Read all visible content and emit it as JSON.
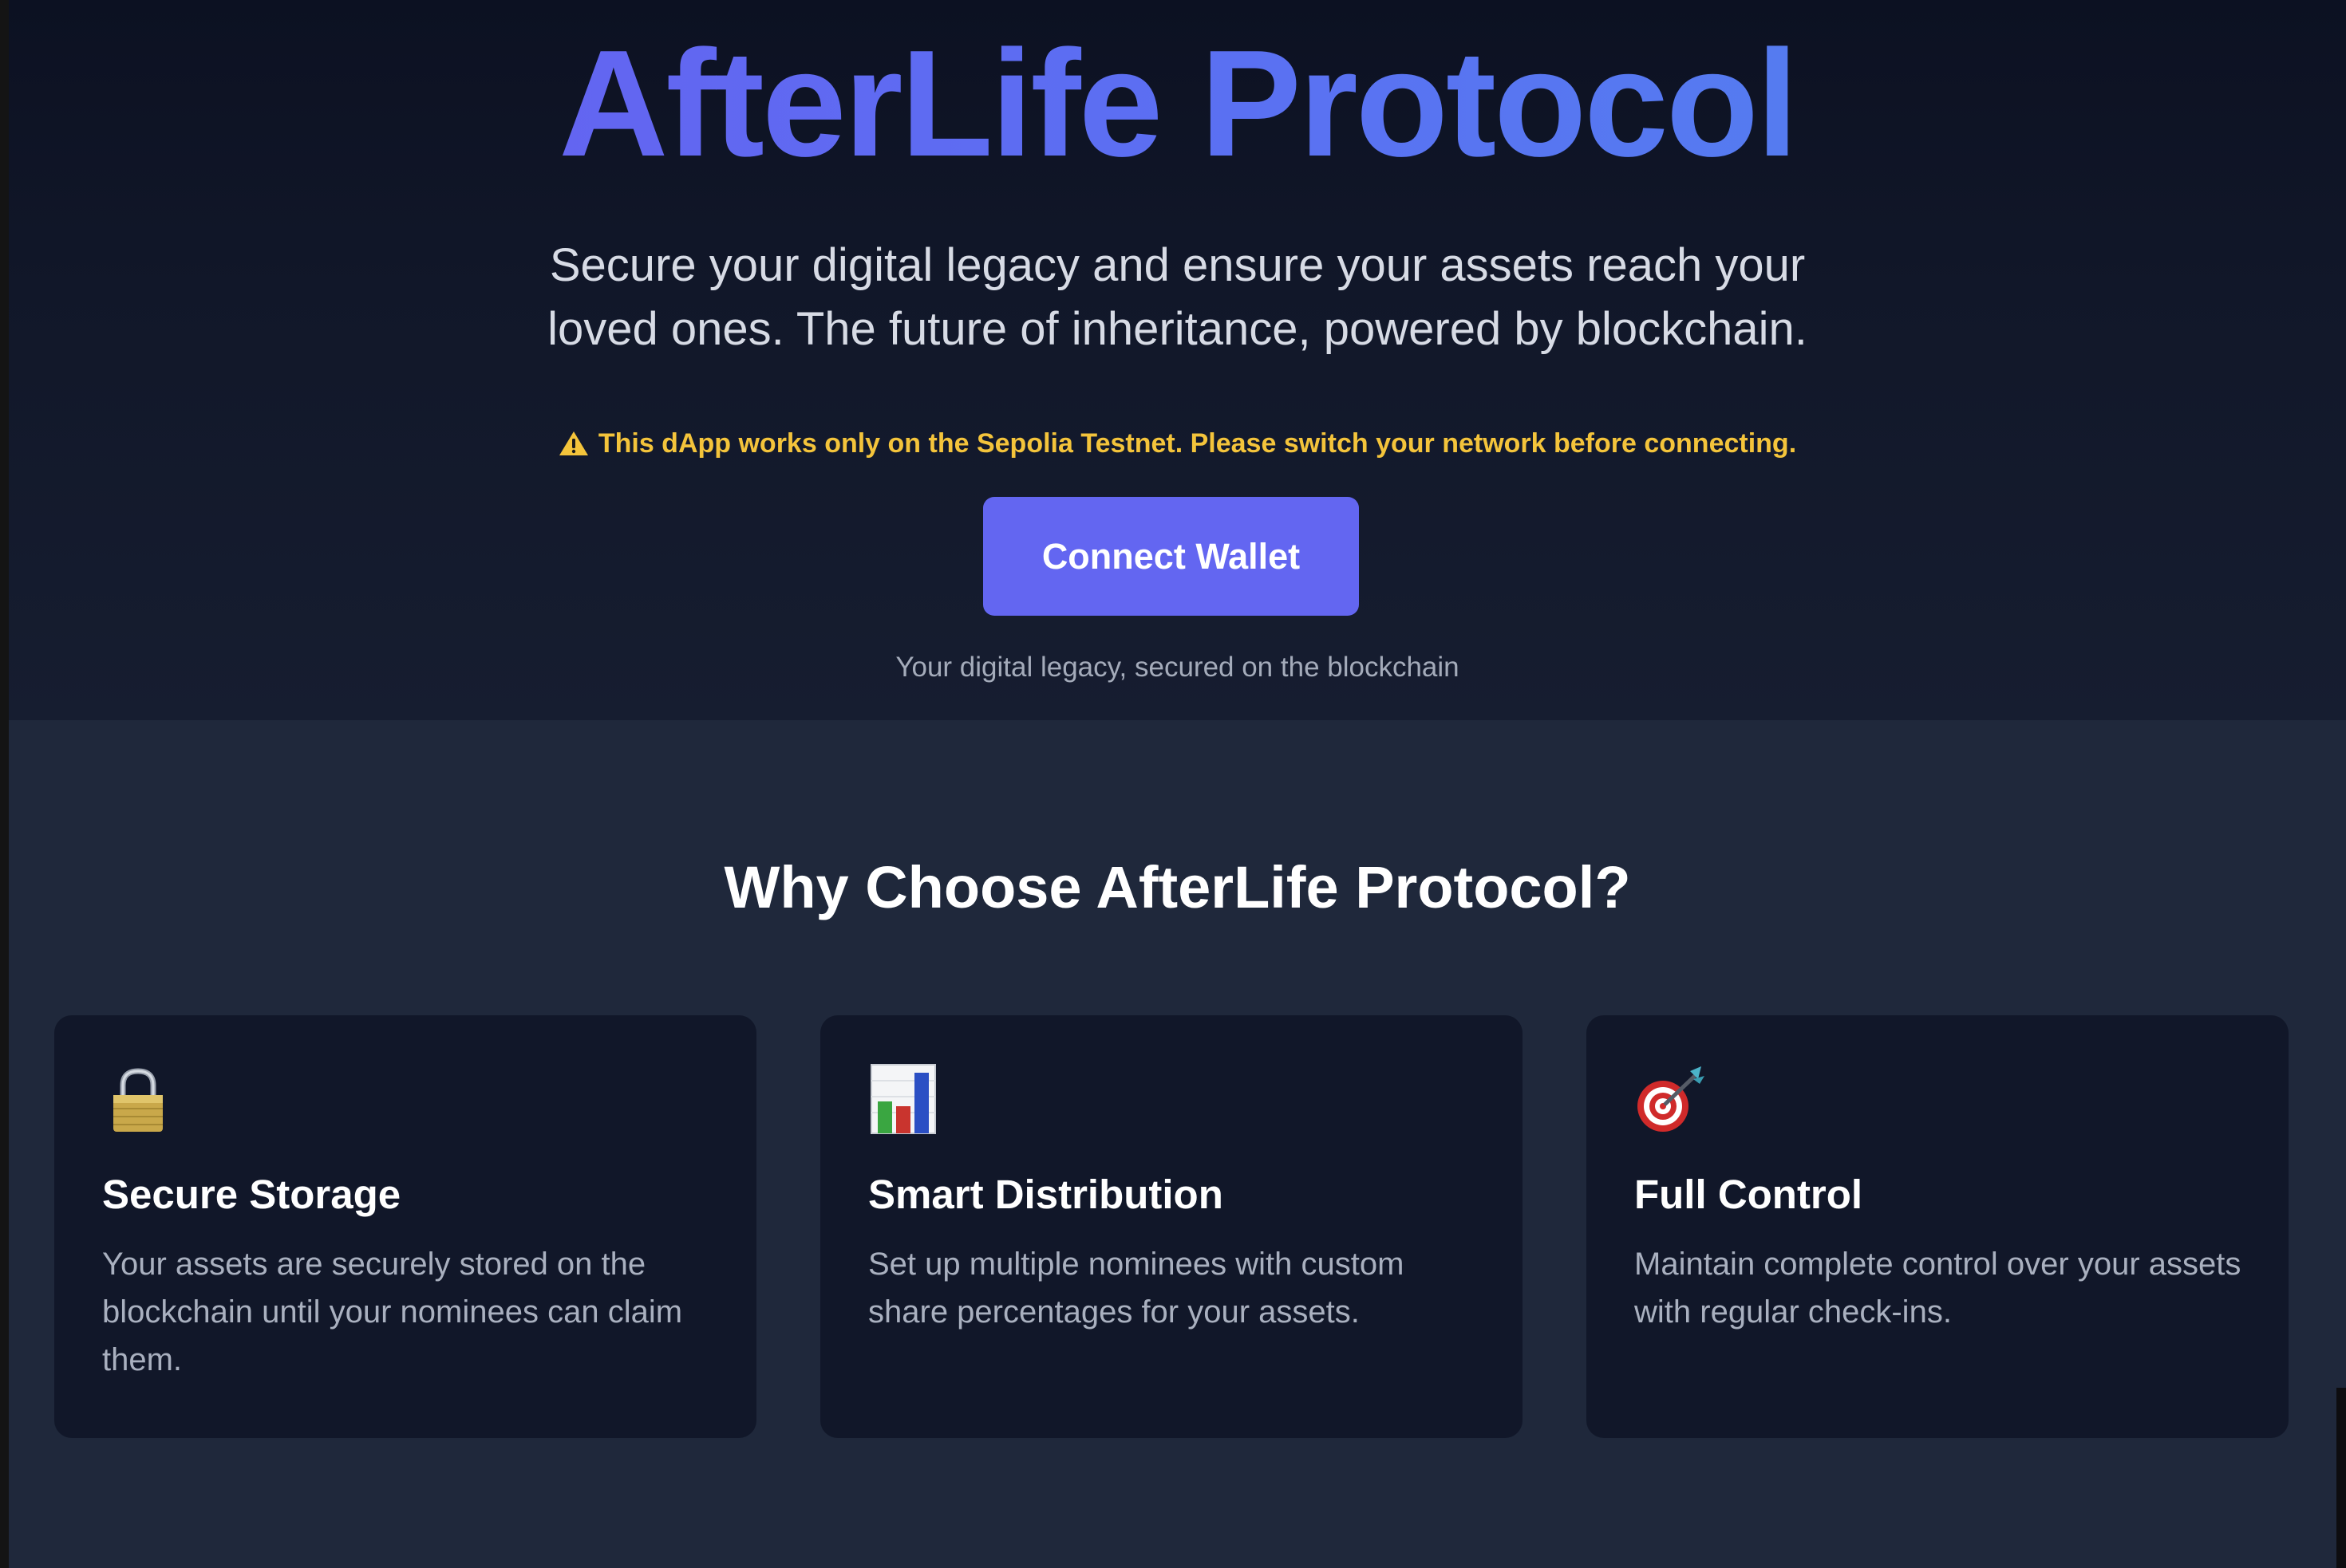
{
  "hero": {
    "title": "AfterLife Protocol",
    "subtitle": "Secure your digital legacy and ensure your assets reach your loved ones. The future of inheritance, powered by blockchain.",
    "warning": "This dApp works only on the Sepolia Testnet. Please switch your network before connecting.",
    "warning_icon": "warning-icon",
    "connect_label": "Connect Wallet",
    "tagline": "Your digital legacy, secured on the blockchain"
  },
  "features": {
    "title": "Why Choose AfterLife Protocol?",
    "cards": [
      {
        "icon": "lock-icon",
        "title": "Secure Storage",
        "description": "Your assets are securely stored on the blockchain until your nominees can claim them."
      },
      {
        "icon": "bar-chart-icon",
        "title": "Smart Distribution",
        "description": "Set up multiple nominees with custom share percentages for your assets."
      },
      {
        "icon": "target-icon",
        "title": "Full Control",
        "description": "Maintain complete control over your assets with regular check-ins."
      }
    ]
  },
  "colors": {
    "accent": "#6366f1",
    "warning": "#f4c43b",
    "hero_bg": "#111729",
    "features_bg": "#1f283b",
    "card_bg": "#111729"
  }
}
